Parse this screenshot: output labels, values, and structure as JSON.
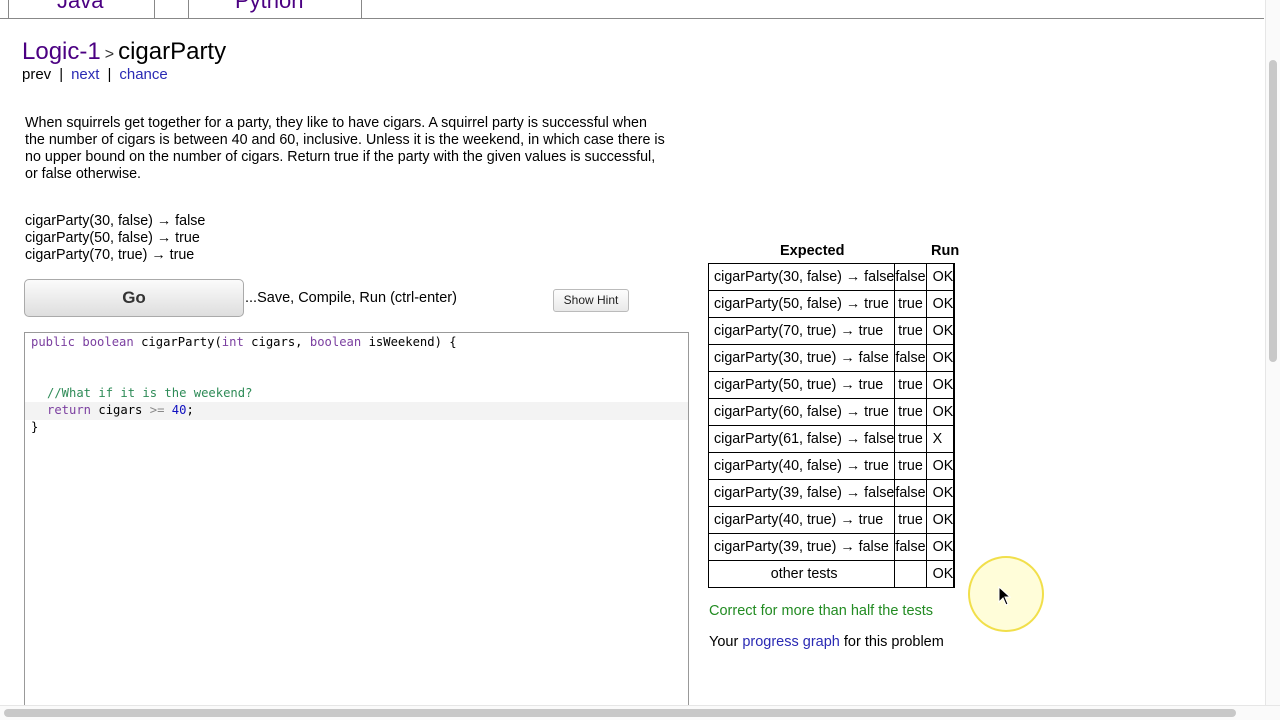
{
  "tabs": [
    {
      "label": "Java"
    },
    {
      "label": "Python"
    }
  ],
  "breadcrumb": {
    "category": "Logic-1",
    "separator": ">",
    "problem": "cigarParty"
  },
  "nav": {
    "prev": "prev",
    "next": "next",
    "chance": "chance",
    "separator": "|"
  },
  "description": "When squirrels get together for a party, they like to have cigars. A squirrel party is successful when the number of cigars is between 40 and 60, inclusive. Unless it is the weekend, in which case there is no upper bound on the number of cigars. Return true if the party with the given values is successful, or false otherwise.",
  "examples": [
    "cigarParty(30, false) → false",
    "cigarParty(50, false) → true",
    "cigarParty(70, true) → true"
  ],
  "go_button": "Go",
  "go_note": "...Save, Compile, Run (ctrl-enter)",
  "hint_button": "Show Hint",
  "code": {
    "line1_kw1": "public boolean",
    "line1_mid1": " cigarParty(",
    "line1_kw2": "int",
    "line1_mid2": " cigars, ",
    "line1_kw3": "boolean",
    "line1_end": " isWeekend) {",
    "comment": "//What if it is the weekend?",
    "return_kw": "return",
    "return_var": " cigars ",
    "return_op": ">=",
    "return_num": "40",
    "return_end": ";",
    "closing": "}"
  },
  "results": {
    "header_expected": "Expected",
    "header_run": "Run",
    "rows": [
      {
        "expected": "cigarParty(30, false) → false",
        "run": "false",
        "status": "OK",
        "color": "#008000"
      },
      {
        "expected": "cigarParty(50, false) → true",
        "run": "true",
        "status": "OK",
        "color": "#008000"
      },
      {
        "expected": "cigarParty(70, true) → true",
        "run": "true",
        "status": "OK",
        "color": "#008000"
      },
      {
        "expected": "cigarParty(30, true) → false",
        "run": "false",
        "status": "OK",
        "color": "#008000"
      },
      {
        "expected": "cigarParty(50, true) → true",
        "run": "true",
        "status": "OK",
        "color": "#008000"
      },
      {
        "expected": "cigarParty(60, false) → true",
        "run": "true",
        "status": "OK",
        "color": "#008000"
      },
      {
        "expected": "cigarParty(61, false) → false",
        "run": "true",
        "status": "X",
        "color": "#ff0000"
      },
      {
        "expected": "cigarParty(40, false) → true",
        "run": "true",
        "status": "OK",
        "color": "#008000"
      },
      {
        "expected": "cigarParty(39, false) → false",
        "run": "false",
        "status": "OK",
        "color": "#008000"
      },
      {
        "expected": "cigarParty(40, true) → true",
        "run": "true",
        "status": "OK",
        "color": "#008000"
      },
      {
        "expected": "cigarParty(39, true) → false",
        "run": "false",
        "status": "OK",
        "color": "#008000"
      }
    ],
    "other_label": "other tests",
    "other_status": "OK",
    "other_color": "#008000"
  },
  "summary": "Correct for more than half the tests",
  "progress": {
    "prefix": "Your ",
    "link": "progress graph",
    "suffix": " for this problem"
  }
}
